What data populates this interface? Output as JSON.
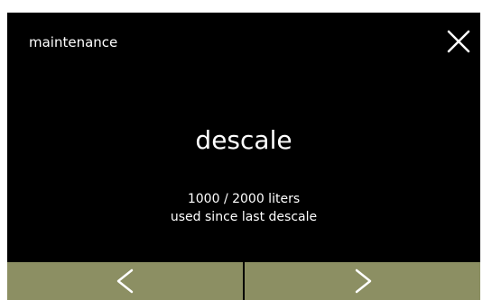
{
  "header": {
    "title": "maintenance",
    "close_icon": "close-icon"
  },
  "main": {
    "title": "descale",
    "usage_line": "1000 / 2000 liters",
    "usage_caption": "used since last descale",
    "usage_current_liters": 1000,
    "usage_limit_liters": 2000
  },
  "nav": {
    "prev_icon": "chevron-left-icon",
    "next_icon": "chevron-right-icon"
  },
  "colors": {
    "screen_background": "#000000",
    "text": "#ffffff",
    "nav_background": "#8c8f63"
  }
}
